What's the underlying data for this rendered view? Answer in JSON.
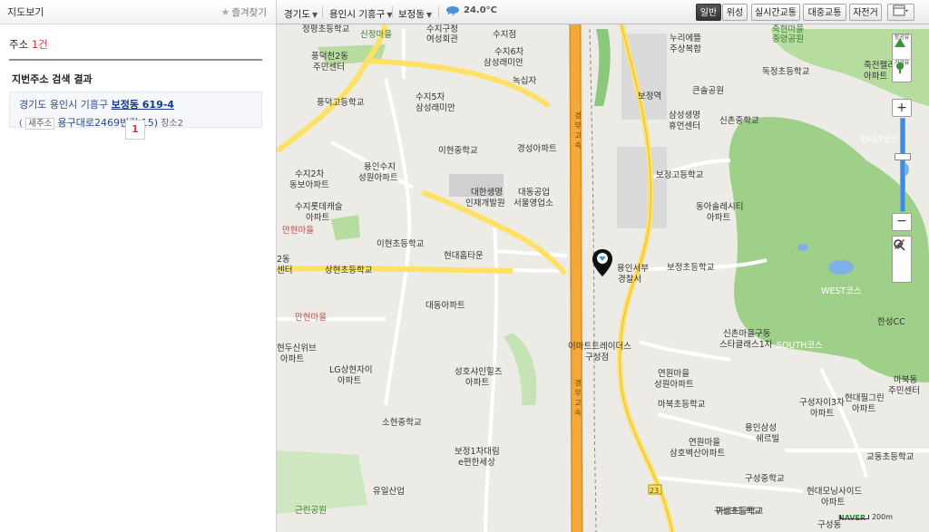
{
  "sidebar": {
    "title": "지도보기",
    "favorite_label": "즐겨찾기",
    "addr_label": "주소",
    "addr_count": "1건",
    "section_title": "지번주소 검색 결과",
    "result": {
      "prefix": "경기도 용인시 기흥구",
      "highlight": "보정동 619-4",
      "new_open": "(",
      "new_tag": "새주소",
      "road": "용구대로2469번길 15)",
      "extra": "장소2"
    },
    "page": "1"
  },
  "toolbar": {
    "crumb1": "경기도",
    "crumb2": "용인시 기흥구",
    "crumb3": "보정동",
    "temperature": "24.0°C",
    "btn_normal": "일반",
    "btn_satellite": "위성",
    "btn_traffic": "실시간교통",
    "btn_transit": "대중교통",
    "btn_bike": "자전거"
  },
  "map": {
    "labels": [
      "정평초등학교",
      "신정마을",
      "수지구청",
      "여성회관",
      "수지점",
      "축현마을",
      "중앙공원",
      "풍덕천2동",
      "주민센터",
      "수지6차",
      "삼성래미안",
      "누리에뜰",
      "주상복합",
      "독정초등학교",
      "죽전펠리스",
      "아파트",
      "녹십자",
      "수지5차",
      "삼성래미안",
      "풍덕고등학교",
      "보정역",
      "큰솔공원",
      "삼성생명",
      "휴먼센터",
      "신촌중학교",
      "이현중학교",
      "경성아파트",
      "EAST코스",
      "수지2차",
      "동보아파트",
      "용인수지",
      "성원아파트",
      "보정고등학교",
      "대한생명",
      "인재개발원",
      "대동공업",
      "서울영업소",
      "수지롯데캐슬",
      "아파트",
      "동아솔레시티",
      "아파트",
      "만현마을",
      "이현초등학교",
      "현대홈타운",
      "2동",
      "센터",
      "상현초등학교",
      "용인서부",
      "경찰서",
      "보정초등학교",
      "WEST코스",
      "대동아파트",
      "만현마을",
      "한성CC",
      "신촌마을구동",
      "스타클래스1차",
      "SOUTH코스",
      "현두신위브",
      "아파트",
      "이마트트레이더스",
      "구성점",
      "LG상현자이",
      "아파트",
      "성호샤인힐즈",
      "아파트",
      "연원마을",
      "성원아파트",
      "마북동",
      "주민센터",
      "마북초등학교",
      "구성자이3차",
      "현대필그린",
      "아파트",
      "아파트",
      "소현중학교",
      "용인삼성",
      "쉐르빌",
      "연원마을",
      "삼호벽산아파트",
      "보정1차대림",
      "e편한세상",
      "교동초등학교",
      "구성중학교",
      "현대모닝사이드",
      "아파트",
      "구성초등학교",
      "유일산업",
      "마성초등학교",
      "구성동",
      "근린공원",
      "경부고속",
      "경부고속",
      "23"
    ],
    "scale": "200m",
    "brand": "NAVER",
    "zoom_labels": [
      "항공뷰",
      "거리뷰"
    ]
  },
  "colors": {
    "highway": "#f2a93a",
    "road": "#ffe168",
    "green": "#9fd08a",
    "land": "#ecebe6"
  }
}
